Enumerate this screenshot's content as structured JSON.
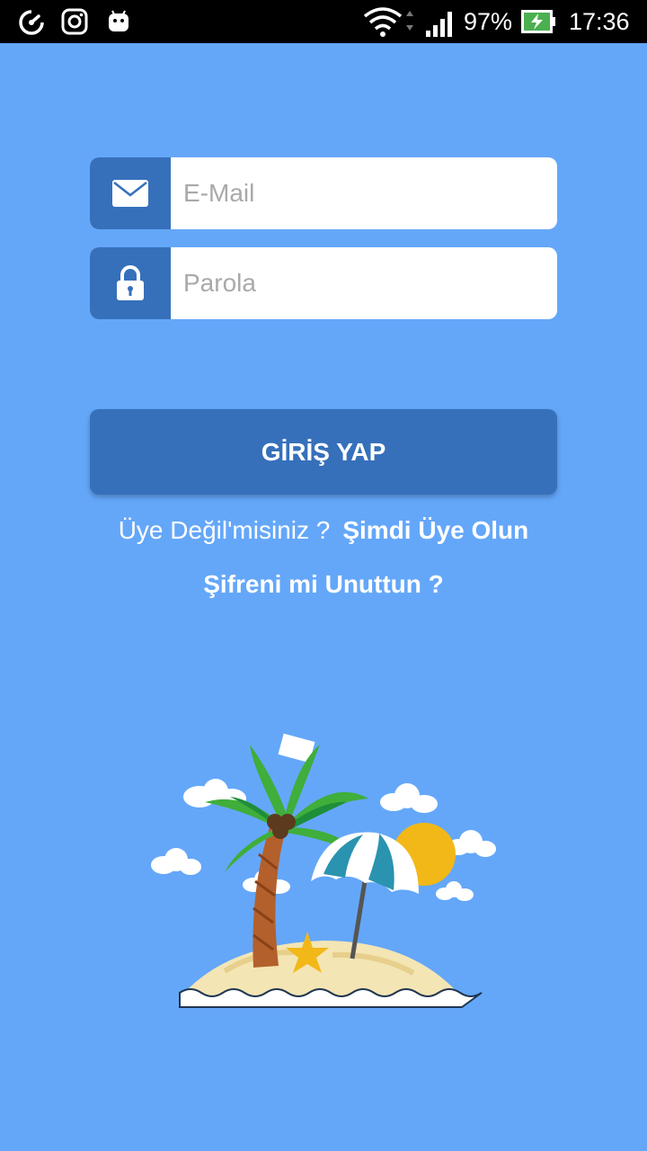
{
  "status_bar": {
    "battery_percent": "97%",
    "time": "17:36",
    "icons": [
      "speedometer-icon",
      "instagram-icon",
      "android-icon",
      "wifi-icon",
      "signal-icon",
      "battery-charging-icon"
    ]
  },
  "login": {
    "email_placeholder": "E-Mail",
    "password_placeholder": "Parola",
    "email_icon": "envelope-icon",
    "password_icon": "lock-icon",
    "submit_label": "GİRİŞ YAP"
  },
  "signup": {
    "prompt": "Üye Değil'misiniz ?",
    "link": "Şimdi Üye Olun"
  },
  "forgot_password": "Şifreni mi Unuttun ?",
  "colors": {
    "background": "#64a7f9",
    "accent": "#3670bb",
    "field": "#ffffff",
    "text": "#ffffff"
  }
}
